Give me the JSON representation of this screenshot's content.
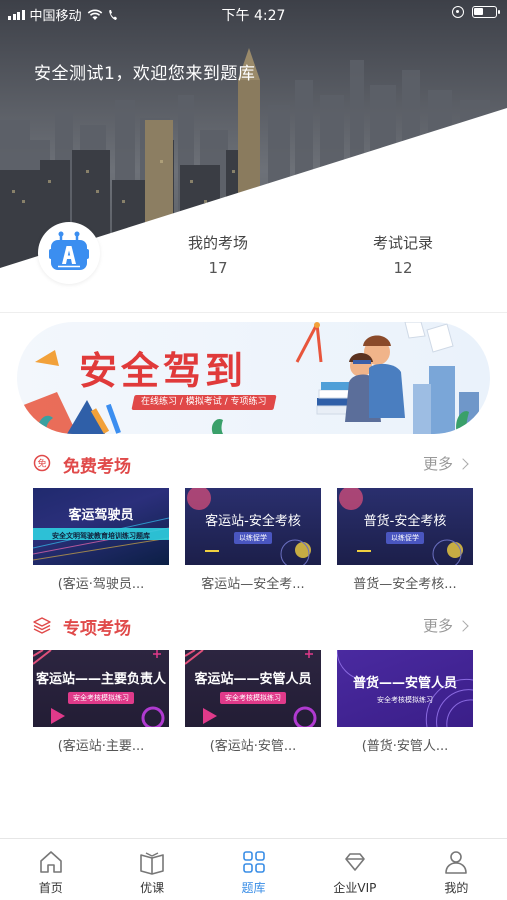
{
  "status_bar": {
    "carrier": "中国移动",
    "time": "下午 4:27"
  },
  "header": {
    "welcome_text": "安全测试1，欢迎您来到题库"
  },
  "stats": [
    {
      "label": "我的考场",
      "value": "17"
    },
    {
      "label": "考试记录",
      "value": "12"
    }
  ],
  "banner": {
    "title": "安全驾到",
    "tags": "在线练习 / 模拟考试 / 专项练习"
  },
  "free_section": {
    "title": "免费考场",
    "more_label": "更多",
    "items": [
      {
        "thumb_title": "客运驾驶员",
        "thumb_sub": "安全文明驾驶教育培训练习题库",
        "caption": "(客运·驾驶员..."
      },
      {
        "thumb_title": "客运站-安全考核",
        "thumb_sub": "以练促学",
        "caption": "客运站—安全考..."
      },
      {
        "thumb_title": "普货-安全考核",
        "thumb_sub": "以练促学",
        "caption": "普货—安全考核..."
      }
    ]
  },
  "special_section": {
    "title": "专项考场",
    "more_label": "更多",
    "items": [
      {
        "thumb_title": "客运站——主要负责人",
        "thumb_sub": "安全考核模拟练习",
        "caption": "(客运站·主要..."
      },
      {
        "thumb_title": "客运站——安管人员",
        "thumb_sub": "安全考核模拟练习",
        "caption": "(客运站·安管..."
      },
      {
        "thumb_title": "普货——安管人员",
        "thumb_sub": "安全考核模拟练习",
        "caption": "(普货·安管人..."
      }
    ]
  },
  "tabbar": {
    "items": [
      {
        "label": "首页",
        "icon": "home-icon"
      },
      {
        "label": "优课",
        "icon": "book-icon"
      },
      {
        "label": "题库",
        "icon": "grid-icon",
        "active": true
      },
      {
        "label": "企业VIP",
        "icon": "diamond-icon"
      },
      {
        "label": "我的",
        "icon": "user-icon"
      }
    ]
  },
  "colors": {
    "accent_red": "#e04a4a",
    "active_tab": "#3a8ee6"
  }
}
